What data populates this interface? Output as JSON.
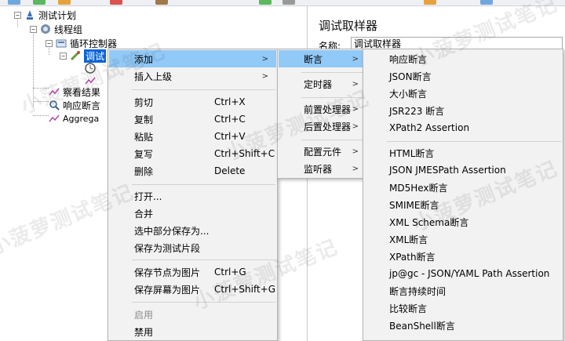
{
  "tree": {
    "items": [
      {
        "label": "测试计划",
        "icon": "test-plan-icon"
      },
      {
        "label": "线程组",
        "icon": "thread-group-icon"
      },
      {
        "label": "循环控制器",
        "icon": "loop-controller-icon"
      },
      {
        "label": "调试",
        "icon": "debug-sampler-icon"
      },
      {
        "label": "察看结果",
        "icon": "listener-icon"
      },
      {
        "label": "响应断言",
        "icon": "assertion-icon"
      },
      {
        "label": "Aggrega",
        "icon": "listener-icon"
      }
    ]
  },
  "right_panel": {
    "title": "调试取样器",
    "name_label": "名称:",
    "name_value": "调试取样器"
  },
  "context_menu": [
    {
      "label": "添加",
      "shortcut": "",
      "submenu": true
    },
    {
      "label": "插入上级",
      "shortcut": "",
      "submenu": true
    },
    {
      "label": "剪切",
      "shortcut": "Ctrl+X"
    },
    {
      "label": "复制",
      "shortcut": "Ctrl+C"
    },
    {
      "label": "粘贴",
      "shortcut": "Ctrl+V"
    },
    {
      "label": "复写",
      "shortcut": "Ctrl+Shift+C"
    },
    {
      "label": "删除",
      "shortcut": "Delete"
    },
    {
      "label": "打开...",
      "shortcut": ""
    },
    {
      "label": "合并",
      "shortcut": ""
    },
    {
      "label": "选中部分保存为...",
      "shortcut": ""
    },
    {
      "label": "保存为测试片段",
      "shortcut": ""
    },
    {
      "label": "保存节点为图片",
      "shortcut": "Ctrl+G"
    },
    {
      "label": "保存屏幕为图片",
      "shortcut": "Ctrl+Shift+G"
    },
    {
      "label": "启用",
      "shortcut": "",
      "disabled": true
    },
    {
      "label": "禁用",
      "shortcut": ""
    }
  ],
  "add_submenu": [
    {
      "label": "断言"
    },
    {
      "label": "定时器"
    },
    {
      "label": "前置处理器"
    },
    {
      "label": "后置处理器"
    },
    {
      "label": "配置元件"
    },
    {
      "label": "监听器"
    }
  ],
  "assertion_submenu": [
    "响应断言",
    "JSON断言",
    "大小断言",
    "JSR223 断言",
    "XPath2 Assertion",
    "HTML断言",
    "JSON JMESPath Assertion",
    "MD5Hex断言",
    "SMIME断言",
    "XML Schema断言",
    "XML断言",
    "XPath断言",
    "jp@gc - JSON/YAML Path Assertion",
    "断言持续时间",
    "比较断言",
    "BeanShell断言"
  ],
  "watermark": "小菠萝测试笔记",
  "colors": {
    "highlight": "#91c9f7",
    "selection": "#0a64d8",
    "menu_bg": "#f2f2f2"
  }
}
